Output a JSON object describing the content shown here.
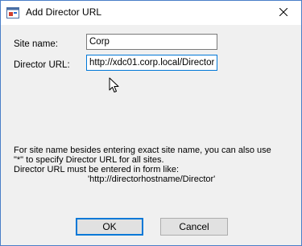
{
  "window": {
    "title": "Add Director URL"
  },
  "form": {
    "site_name_label": "Site name:",
    "site_name_value": "Corp",
    "director_url_label": "Director URL:",
    "director_url_value": "http://xdc01.corp.local/Director"
  },
  "help": {
    "line1": "For site name besides entering exact site name, you can also use",
    "line2": "\"*\" to specify Director URL for all sites.",
    "line3": "Director URL must be entered in form like:",
    "line4": "'http://directorhostname/Director'"
  },
  "buttons": {
    "ok_label": "OK",
    "cancel_label": "Cancel"
  },
  "icons": {
    "app": "app-window-icon",
    "close": "close-icon",
    "pointer": "mouse-pointer-icon"
  }
}
